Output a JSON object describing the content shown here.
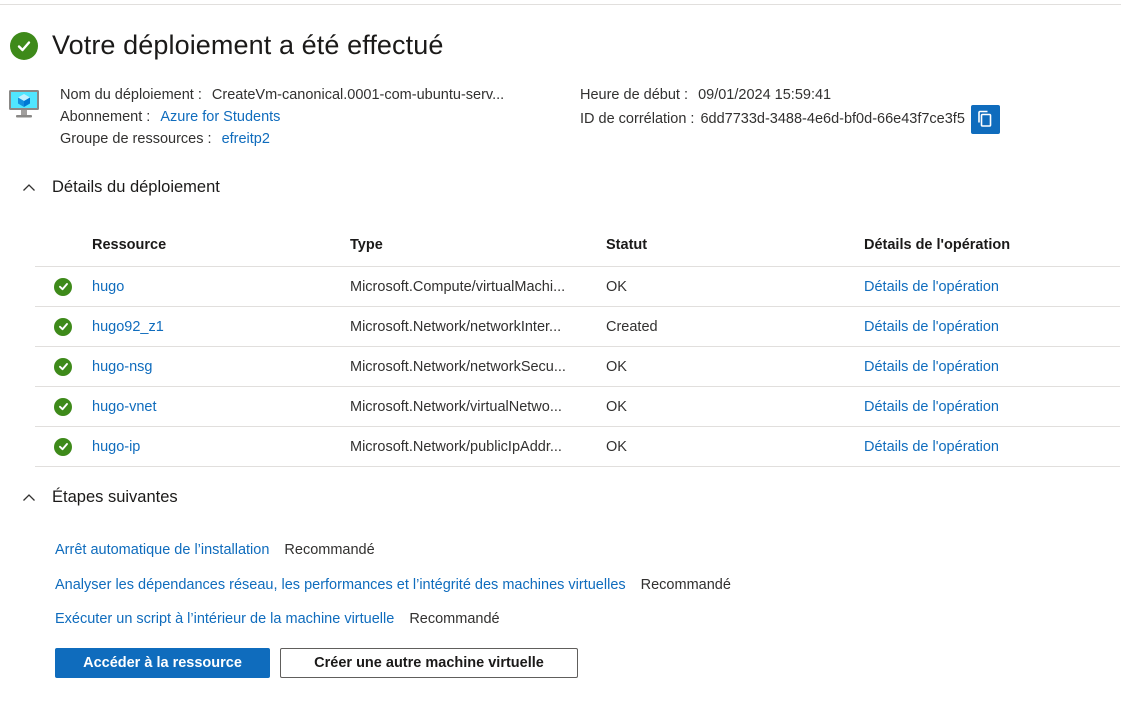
{
  "header": {
    "title": "Votre déploiement a été effectué",
    "status_icon": "success-check-icon",
    "resource_icon": "virtual-machine-icon"
  },
  "meta": {
    "deployment_name_label": "Nom du déploiement :",
    "deployment_name_value": "CreateVm-canonical.0001-com-ubuntu-serv...",
    "subscription_label": "Abonnement :",
    "subscription_value": "Azure for Students",
    "resource_group_label": "Groupe de ressources :",
    "resource_group_value": "efreitp2",
    "start_time_label": "Heure de début :",
    "start_time_value": "09/01/2024 15:59:41",
    "correlation_label": "ID de corrélation :",
    "correlation_value": "6dd7733d-3488-4e6d-bf0d-66e43f7ce3f5",
    "copy_icon": "copy-icon"
  },
  "details": {
    "title": "Détails du déploiement",
    "columns": [
      "Ressource",
      "Type",
      "Statut",
      "Détails de l'opération"
    ],
    "rows": [
      {
        "resource": "hugo",
        "type": "Microsoft.Compute/virtualMachi...",
        "status": "OK",
        "op": "Détails de l'opération"
      },
      {
        "resource": "hugo92_z1",
        "type": "Microsoft.Network/networkInter...",
        "status": "Created",
        "op": "Détails de l'opération"
      },
      {
        "resource": "hugo-nsg",
        "type": "Microsoft.Network/networkSecu...",
        "status": "OK",
        "op": "Détails de l'opération"
      },
      {
        "resource": "hugo-vnet",
        "type": "Microsoft.Network/virtualNetwo...",
        "status": "OK",
        "op": "Détails de l'opération"
      },
      {
        "resource": "hugo-ip",
        "type": "Microsoft.Network/publicIpAddr...",
        "status": "OK",
        "op": "Détails de l'opération"
      }
    ]
  },
  "next_steps": {
    "title": "Étapes suivantes",
    "items": [
      {
        "label": "Arrêt automatique de l’installation",
        "tag": "Recommandé"
      },
      {
        "label": "Analyser les dépendances réseau, les performances et l’intégrité des machines virtuelles",
        "tag": "Recommandé"
      },
      {
        "label": "Exécuter un script à l’intérieur de la machine virtuelle",
        "tag": "Recommandé"
      }
    ]
  },
  "actions": {
    "primary_label": "Accéder à la ressource",
    "secondary_label": "Créer une autre machine virtuelle"
  },
  "colors": {
    "accent": "#0f6cbd",
    "success": "#3e8a1a",
    "text": "#323130",
    "divider": "#e1dfdd"
  }
}
